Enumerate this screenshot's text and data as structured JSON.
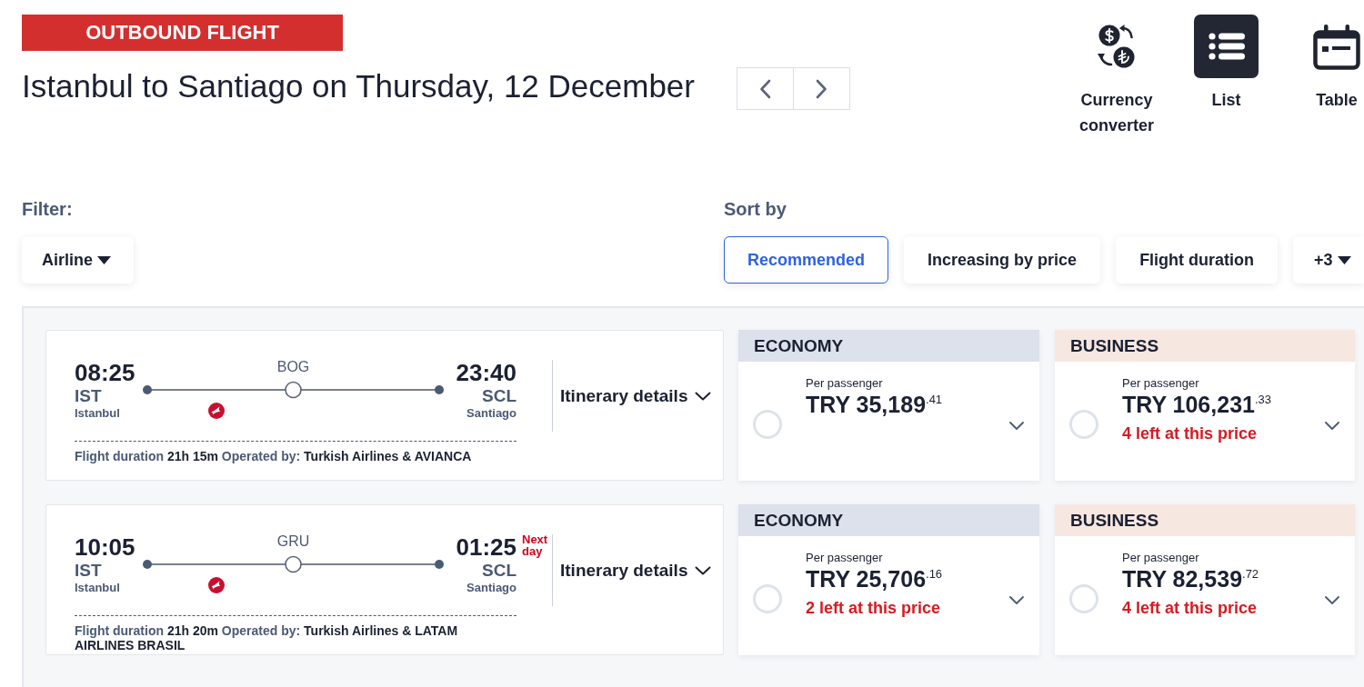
{
  "header": {
    "badge": "OUTBOUND FLIGHT",
    "title": "Istanbul to Santiago on Thursday, 12 December"
  },
  "tools": [
    {
      "kind": "currency",
      "label": "Currency converter"
    }
  ],
  "views": [
    {
      "kind": "list",
      "label": "List",
      "selected": true
    },
    {
      "kind": "table",
      "label": "Table",
      "selected": false
    }
  ],
  "filter": {
    "label": "Filter:",
    "dropdowns": [
      {
        "label": "Airline"
      }
    ]
  },
  "sort": {
    "label": "Sort by",
    "options": [
      {
        "kind": "option",
        "label": "Recommended",
        "selected": true
      },
      {
        "kind": "option",
        "label": "Increasing by price",
        "selected": false
      },
      {
        "kind": "option",
        "label": "Flight duration",
        "selected": false
      },
      {
        "kind": "more",
        "label": "+3",
        "selected": false
      }
    ]
  },
  "flights": [
    {
      "departure": {
        "time": "08:25",
        "code": "IST",
        "city": "Istanbul"
      },
      "stop": "BOG",
      "arrival": {
        "time": "23:40",
        "code": "SCL",
        "city": "Santiago"
      },
      "details": "Itinerary details",
      "duration_label": "Flight duration",
      "duration": "21h 15m",
      "operator_label": "Operated by:",
      "operator": "Turkish Airlines & AVIANCA",
      "fares": [
        {
          "kind": "economy",
          "cabin": "ECONOMY",
          "per": "Per passenger",
          "price": "TRY 35,189$^{.41}$",
          "selected": false
        },
        {
          "kind": "business",
          "cabin": "BUSINESS",
          "per": "Per passenger",
          "price": "TRY 106,231$^{.33}$",
          "availability": "4 left at this price",
          "selected": false
        }
      ]
    },
    {
      "departure": {
        "time": "10:05",
        "code": "IST",
        "city": "Istanbul"
      },
      "stop": "GRU",
      "arrival": {
        "time": "01:25",
        "code": "SCL",
        "city": "Santiago",
        "note": "Next day"
      },
      "details": "Itinerary details",
      "duration_label": "Flight duration",
      "duration": "21h 20m",
      "operator_label": "Operated by:",
      "operator": "Turkish Airlines & LATAM AIRLINES BRASIL",
      "fares": [
        {
          "kind": "economy",
          "cabin": "ECONOMY",
          "per": "Per passenger",
          "price": "TRY 25,706$^{.16}$",
          "availability": "2 left at this price",
          "selected": false
        },
        {
          "kind": "business",
          "cabin": "BUSINESS",
          "per": "Per passenger",
          "price": "TRY 82,539$^{.72}$",
          "availability": "4 left at this price",
          "selected": false
        }
      ]
    }
  ]
}
